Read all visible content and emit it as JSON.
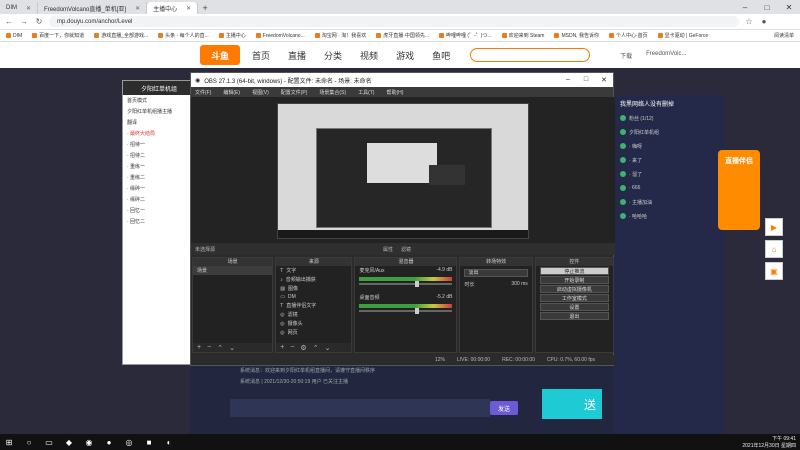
{
  "browser": {
    "tabs": [
      {
        "label": "DIM"
      },
      {
        "label": "FreedomVolcano直播_单机[亚]"
      },
      {
        "label": "主播中心"
      }
    ],
    "url": "mp.douyu.com/anchor/Level",
    "bookmarks": [
      "DIM",
      "百度一下，你就知道",
      "游戏直播_全部游戏...",
      "头条 · 每个人的直...",
      "主播中心",
      "FreedomVolcano...",
      "淘宝网 · 淘！我喜欢",
      "虎牙直播·中国领先...",
      "哔哩哔哩 (゜-゜)つ...",
      "欢迎来到 Steam",
      "MSDN, 我告诉你",
      "个人中心-首页",
      "显卡驱动 | GeForce"
    ],
    "bookmarks_right": "阅读清单"
  },
  "douyu": {
    "logo": "斗鱼",
    "nav": [
      "首页",
      "直播",
      "分类",
      "视频",
      "游戏",
      "鱼吧"
    ],
    "right": [
      "下载",
      "FreedomVolc..."
    ]
  },
  "left_panel": {
    "title": "夕阳红单机组",
    "rows": [
      "首页模式",
      "夕阳红单机组播主播",
      "翻译",
      "· 最终大结局",
      "· 招待一",
      "· 招待二",
      "· 重练一",
      "· 重练二",
      "· 缘碎一",
      "· 缘碎二",
      "· 回忆一",
      "· 回忆二"
    ]
  },
  "right_panel": {
    "header": "我黑网络人没有删掉",
    "counter": "1/12",
    "rows": [
      "粉丝 (1/12)",
      "夕阳红单机组",
      "· 嗨呀",
      "· 来了",
      "· 溜了",
      "· 666",
      "· 主播加油",
      "· 哈哈哈"
    ],
    "banner": "直播伴侣"
  },
  "obs": {
    "title": "OBS 27.1.3 (64-bit, windows) - 配置文件: 未命名 - 场景: 未命名",
    "menu": [
      "文件(F)",
      "编辑(E)",
      "视图(V)",
      "配置文件(P)",
      "场景集合(S)",
      "工具(T)",
      "帮助(H)"
    ],
    "source_bar": [
      "未选择源",
      "属性",
      "滤镜"
    ],
    "docks": {
      "scenes": {
        "title": "场景",
        "items": [
          "场景"
        ]
      },
      "sources": {
        "title": "来源",
        "items": [
          "文字",
          "音频输出捕获",
          "图像",
          "DM",
          "直播伴侣文字",
          "滤镜",
          "摄像头",
          "网页",
          "图片"
        ]
      },
      "mixer": {
        "title": "混音器",
        "rows": [
          {
            "name": "麦克风/Aux",
            "db": "-4.9 dB"
          },
          {
            "name": "桌面音频",
            "db": "-5.2 dB"
          }
        ]
      },
      "transitions": {
        "title": "转场特效",
        "type": "淡出",
        "duration_label": "时长",
        "duration": "300 ms"
      },
      "controls": {
        "title": "控件",
        "buttons": [
          "停止推流",
          "开始录制",
          "启动虚拟摄像机",
          "工作室模式",
          "设置",
          "退出"
        ]
      }
    },
    "status": {
      "live": "LIVE: 00:00:00",
      "rec": "REC: 00:00:00",
      "cpu": "CPU: 0.7%, 60.00 fps",
      "dropped": "12%"
    }
  },
  "chat": {
    "lines": [
      "系统消息：欢迎来到夕阳红单机组直播间，请遵守直播间秩序",
      "系统消息 | 2021/12/30-20:50:19 用户 已关注主播"
    ],
    "send": "发送",
    "gift": "送"
  },
  "taskbar": {
    "time": "下午 09:41",
    "date": "2021年12月30日 星期四"
  }
}
